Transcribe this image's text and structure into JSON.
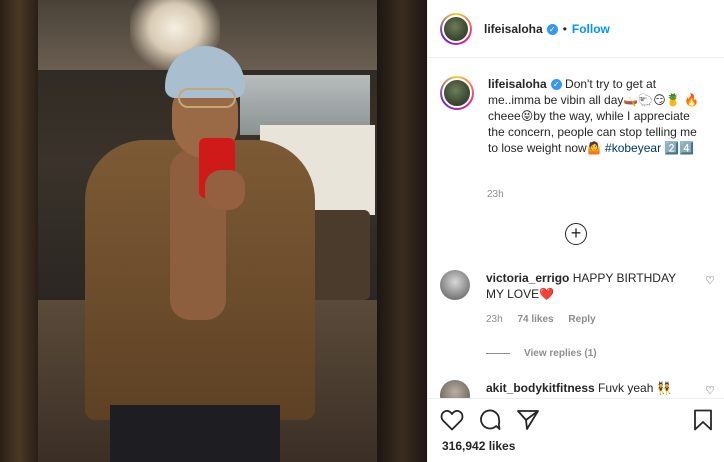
{
  "post": {
    "username": "lifeisaloha",
    "verified_mark": "✓",
    "separator": "•",
    "follow_label": "Follow"
  },
  "caption": {
    "username": "lifeisaloha",
    "text_part1": "Don't try to get at me..imma be vibin all day",
    "emoji1": "🛶🐑😏🍍",
    "emoji2": "🔥",
    "text_part2": "cheee",
    "emoji3": "😝",
    "text_part3": "by the way, while I appreciate the concern, people can stop telling me to lose weight now",
    "emoji4": "🤷",
    "hashtag": "#kobeyear",
    "tag_suffix": "2️⃣4️⃣",
    "time": "23h"
  },
  "comments": [
    {
      "username": "victoria_errigo",
      "text": "HAPPY BIRTHDAY MY LOVE",
      "emoji": "❤️",
      "time": "23h",
      "likes": "74 likes",
      "reply_label": "Reply",
      "view_replies": "View replies (1)"
    },
    {
      "username": "akit_bodykitfitness",
      "text": "Fuvk yeah",
      "emoji": "👯"
    }
  ],
  "actions": {
    "likes_count": "316,942 likes"
  },
  "icons": {
    "heart": "heart-icon",
    "comment": "comment-icon",
    "share": "share-icon",
    "save": "save-icon",
    "add": "add-circle-icon"
  },
  "colors": {
    "follow": "#0095f6",
    "verified": "#3897f0",
    "hashtag": "#00376b",
    "muted": "#8e8e8e"
  }
}
